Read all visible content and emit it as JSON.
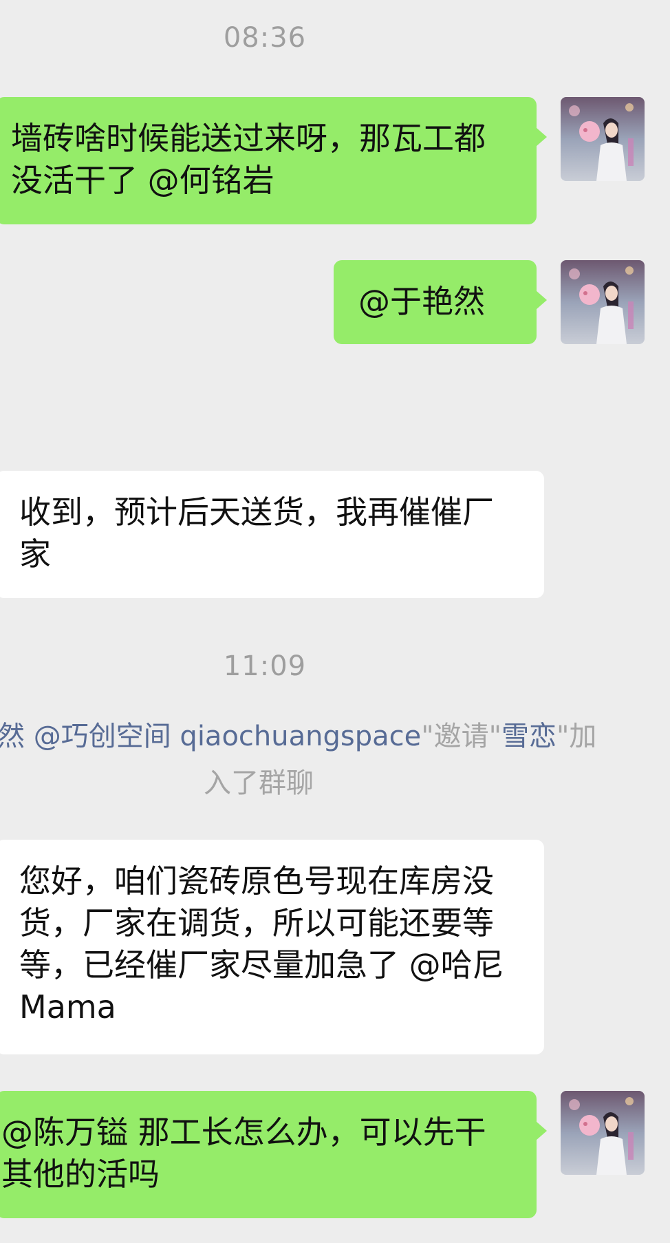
{
  "messages": {
    "time_1": "08:36",
    "msg_1": "墙砖啥时候能送过来呀，那瓦工都没活干了 @何铭岩",
    "msg_2": "@于艳然",
    "msg_3": "收到，预计后天送货，我再催催厂家",
    "time_2": "11:09",
    "system": {
      "prefix_name": "然 @巧创空间 qiaochuangspace",
      "q1": "\"邀请\"",
      "invitee": "雪恋",
      "q2": "\"加",
      "line2": "入了群聊"
    },
    "msg_4": "您好，咱们瓷砖原色号现在库房没货，厂家在调货，所以可能还要等等，已经催厂家尽量加急了 @哈尼 Mama",
    "msg_5": "@陈万镒 那工长怎么办，可以先干其他的活吗"
  },
  "colors": {
    "background": "#ededed",
    "my_bubble": "#95ec69",
    "other_bubble": "#ffffff",
    "timestamp": "#9e9e9e",
    "mention_link": "#576b95"
  },
  "icons": {
    "avatar": "avatar-photo"
  }
}
